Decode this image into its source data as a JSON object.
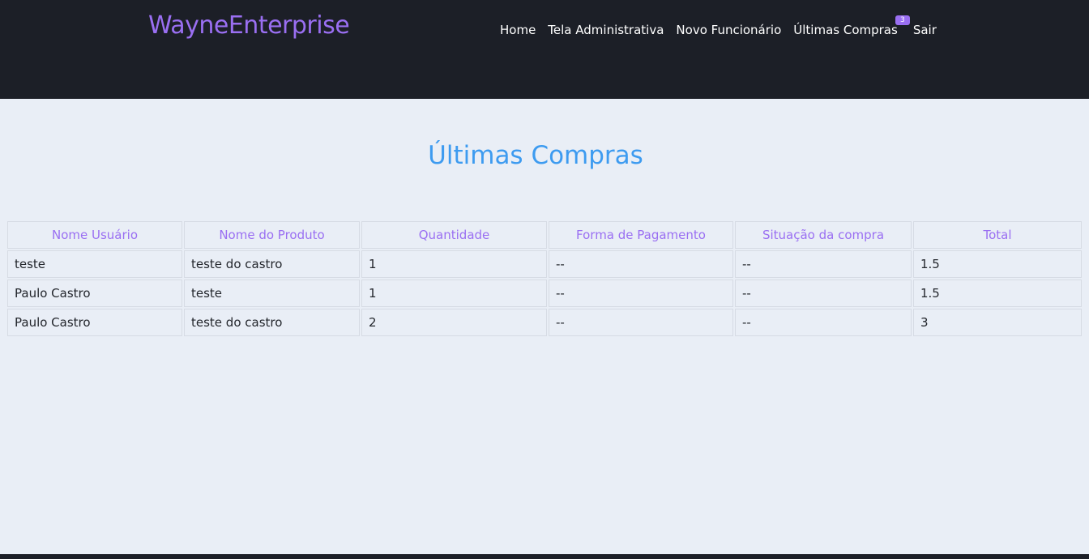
{
  "header": {
    "brand": "WayneEnterprise",
    "nav": {
      "home": "Home",
      "admin": "Tela Administrativa",
      "new_employee": "Novo Funcionário",
      "last_purchases": "Últimas Compras",
      "last_purchases_badge": "3",
      "logout": "Sair"
    }
  },
  "main": {
    "title": "Últimas Compras",
    "table": {
      "columns": [
        "Nome Usuário",
        "Nome do Produto",
        "Quantidade",
        "Forma de Pagamento",
        "Situação da compra",
        "Total"
      ],
      "rows": [
        [
          "teste",
          "teste do castro",
          "1",
          "--",
          "--",
          "1.5"
        ],
        [
          "Paulo Castro",
          "teste",
          "1",
          "--",
          "--",
          "1.5"
        ],
        [
          "Paulo Castro",
          "teste do castro",
          "2",
          "--",
          "--",
          "3"
        ]
      ]
    }
  },
  "colors": {
    "header_bg": "#1c1f27",
    "page_bg": "#e9eef6",
    "accent_purple": "#9a6ff2",
    "title_blue": "#3d9bf0"
  }
}
